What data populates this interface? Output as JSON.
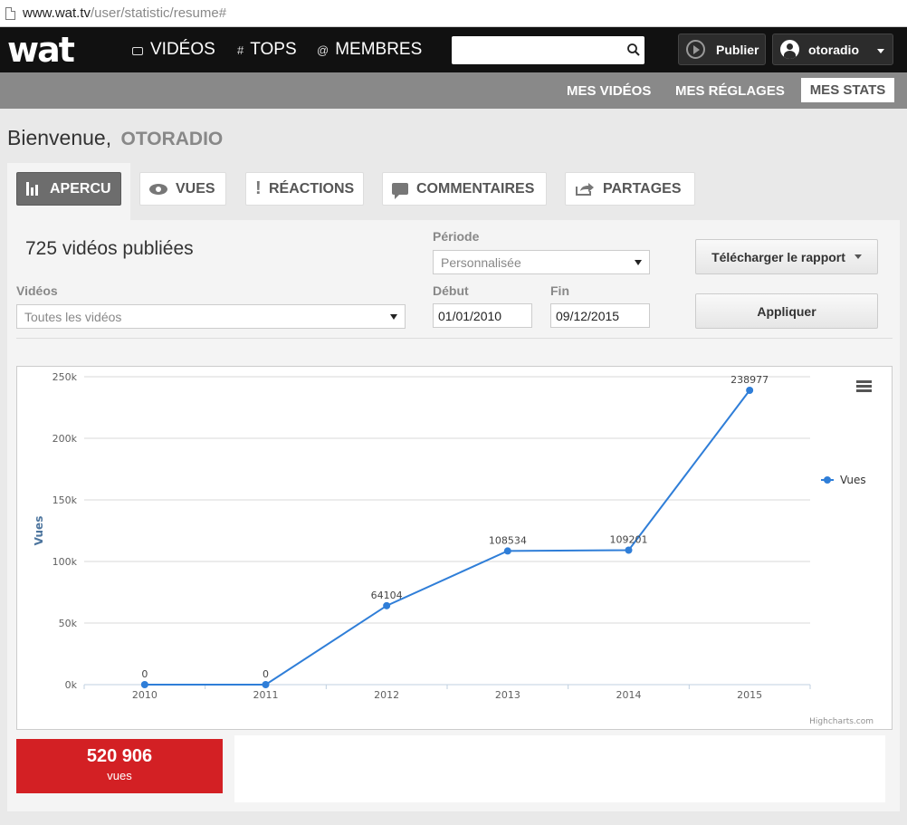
{
  "browser": {
    "url_host": "www.wat.tv",
    "url_path": "/user/statistic/resume#"
  },
  "topnav": {
    "logo": "wat",
    "links": [
      {
        "icon": "tv-icon",
        "label": "VIDÉOS"
      },
      {
        "icon": "hash",
        "label": "TOPS"
      },
      {
        "icon": "at",
        "label": "MEMBRES"
      }
    ],
    "hash_glyph": "#",
    "at_glyph": "@",
    "search_placeholder": "",
    "publish_label": "Publier",
    "username": "otoradio"
  },
  "subnav": {
    "items": [
      "MES VIDÉOS",
      "MES RÉGLAGES",
      "MES STATS"
    ],
    "active": "MES STATS"
  },
  "welcome": {
    "greeting": "Bienvenue,",
    "username": "OTORADIO"
  },
  "tabs": [
    "APERCU",
    "VUES",
    "RÉACTIONS",
    "COMMENTAIRES",
    "PARTAGES"
  ],
  "active_tab": "APERCU",
  "filters": {
    "published_count": "725 vidéos publiées",
    "videos_label": "Vidéos",
    "videos_value": "Toutes les vidéos",
    "period_label": "Période",
    "period_value": "Personnalisée",
    "start_label": "Début",
    "start_value": "01/01/2010",
    "end_label": "Fin",
    "end_value": "09/12/2015",
    "download_label": "Télécharger le rapport",
    "apply_label": "Appliquer"
  },
  "chart_data": {
    "type": "line",
    "categories": [
      "2010",
      "2011",
      "2012",
      "2013",
      "2014",
      "2015"
    ],
    "series": [
      {
        "name": "Vues",
        "values": [
          0,
          0,
          64104,
          108534,
          109201,
          238977
        ]
      }
    ],
    "ylabel": "Vues",
    "xlabel": "",
    "ylim": [
      0,
      250000
    ],
    "yticks": [
      0,
      50000,
      100000,
      150000,
      200000,
      250000
    ],
    "ytick_labels": [
      "0k",
      "50k",
      "100k",
      "150k",
      "200k",
      "250k"
    ],
    "grid": true,
    "legend": "right",
    "credit": "Highcharts.com",
    "color": "#2f7ed8"
  },
  "total": {
    "value": "520 906",
    "label": "vues",
    "color": "#d32024"
  }
}
